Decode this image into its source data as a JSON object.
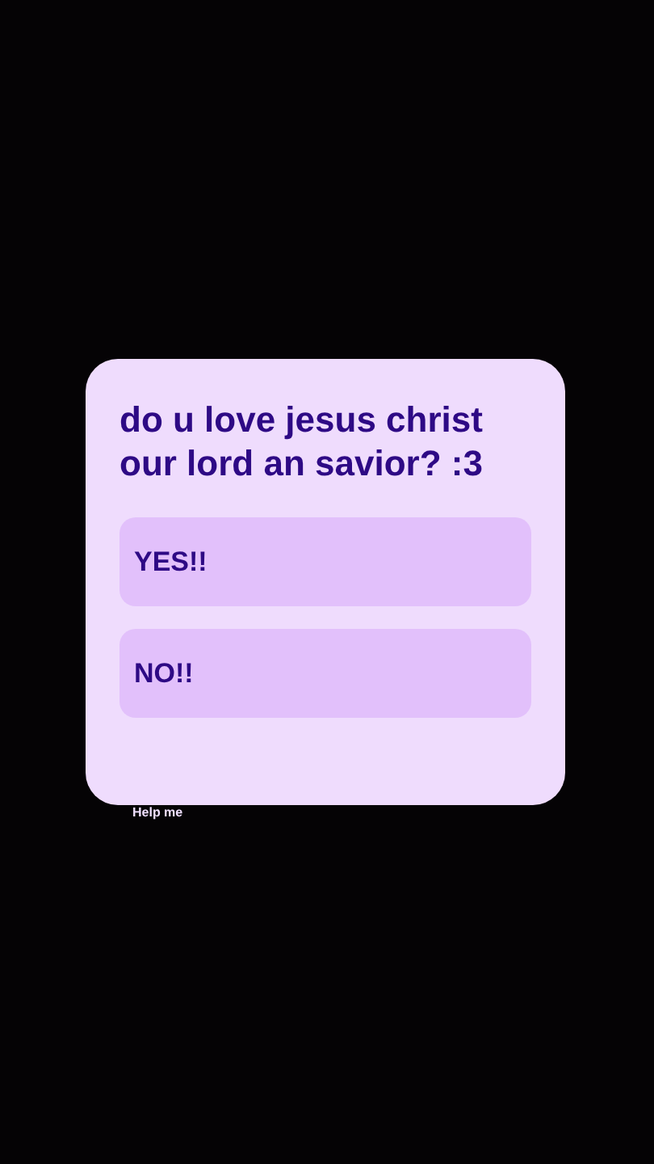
{
  "dialog": {
    "question": "do u love jesus christ our lord an savior? :3",
    "options": [
      {
        "label": "YES!!"
      },
      {
        "label": "NO!!"
      }
    ]
  },
  "caption": "Help me"
}
